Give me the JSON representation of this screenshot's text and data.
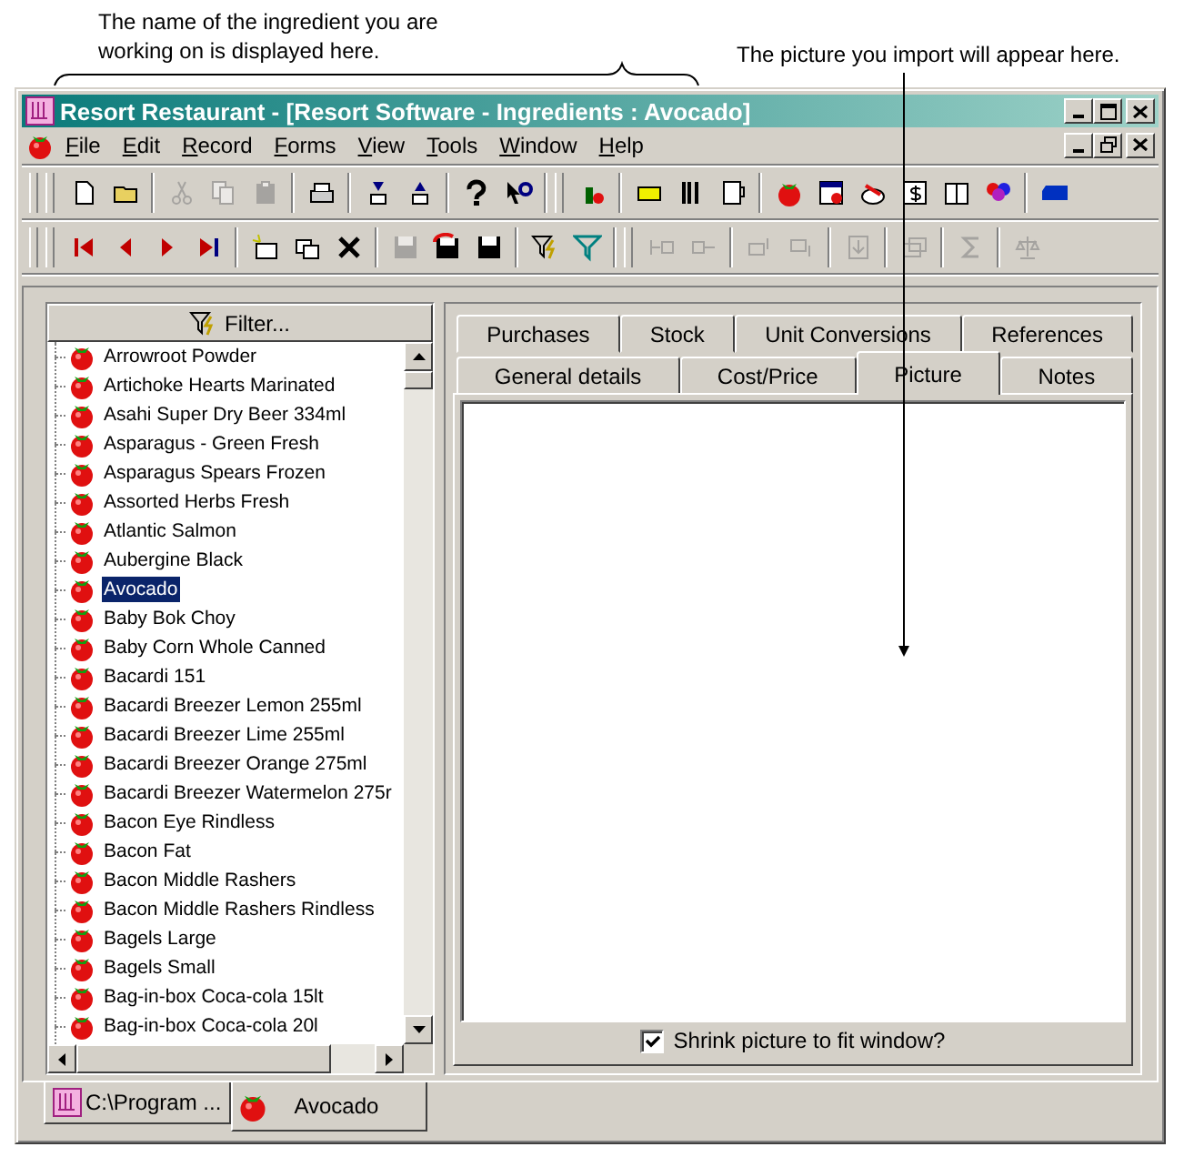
{
  "annotations": [
    {
      "kind": "bracket",
      "text": "The name of the ingredient you are working on is displayed here."
    },
    {
      "kind": "arrow",
      "text": "The picture you import will appear here."
    }
  ],
  "window": {
    "title": "Resort Restaurant - [Resort Software - Ingredients : Avocado]"
  },
  "menu": [
    "File",
    "Edit",
    "Record",
    "Forms",
    "View",
    "Tools",
    "Window",
    "Help"
  ],
  "toolbar_1": [
    {
      "disabled": false
    },
    {
      "disabled": false
    },
    {
      "disabled": true
    },
    {
      "disabled": true
    },
    {
      "disabled": true
    },
    {
      "disabled": false
    },
    {
      "disabled": false
    },
    {
      "disabled": false
    },
    {
      "disabled": false
    },
    {
      "disabled": false
    },
    {
      "disabled": false
    },
    {
      "disabled": false
    },
    {
      "disabled": false
    },
    {
      "disabled": false
    },
    {
      "disabled": false
    },
    {
      "disabled": false
    },
    {
      "disabled": false
    },
    {
      "disabled": false
    },
    {
      "disabled": false
    },
    {
      "disabled": false
    },
    {
      "disabled": false
    }
  ],
  "toolbar_2": [
    {
      "disabled": false
    },
    {
      "disabled": false
    },
    {
      "disabled": false
    },
    {
      "disabled": false
    },
    {
      "disabled": false
    },
    {
      "disabled": false
    },
    {
      "disabled": false
    },
    {
      "disabled": true
    },
    {
      "disabled": false
    },
    {
      "disabled": false
    },
    {
      "disabled": false
    },
    {
      "disabled": false
    },
    {
      "disabled": true
    },
    {
      "disabled": true
    },
    {
      "disabled": true
    },
    {
      "disabled": true
    },
    {
      "disabled": true
    },
    {
      "disabled": true
    },
    {
      "disabled": true
    },
    {
      "disabled": true
    }
  ],
  "filter_button": "Filter...",
  "ingredients": [
    {
      "name": "Arrowroot Powder",
      "selected": false
    },
    {
      "name": "Artichoke Hearts Marinated",
      "selected": false
    },
    {
      "name": "Asahi Super Dry Beer 334ml",
      "selected": false
    },
    {
      "name": "Asparagus - Green Fresh",
      "selected": false
    },
    {
      "name": "Asparagus Spears Frozen",
      "selected": false
    },
    {
      "name": "Assorted Herbs Fresh",
      "selected": false
    },
    {
      "name": "Atlantic Salmon",
      "selected": false
    },
    {
      "name": "Aubergine Black",
      "selected": false
    },
    {
      "name": "Avocado",
      "selected": true
    },
    {
      "name": "Baby Bok Choy",
      "selected": false
    },
    {
      "name": "Baby Corn Whole Canned",
      "selected": false
    },
    {
      "name": "Bacardi 151",
      "selected": false
    },
    {
      "name": "Bacardi Breezer Lemon 255ml",
      "selected": false
    },
    {
      "name": "Bacardi Breezer Lime 255ml",
      "selected": false
    },
    {
      "name": "Bacardi Breezer Orange 275ml",
      "selected": false
    },
    {
      "name": "Bacardi Breezer Watermelon 275r",
      "selected": false
    },
    {
      "name": "Bacon Eye Rindless",
      "selected": false
    },
    {
      "name": "Bacon Fat",
      "selected": false
    },
    {
      "name": "Bacon Middle Rashers",
      "selected": false
    },
    {
      "name": "Bacon Middle Rashers Rindless",
      "selected": false
    },
    {
      "name": "Bagels Large",
      "selected": false
    },
    {
      "name": "Bagels Small",
      "selected": false
    },
    {
      "name": "Bag-in-box Coca-cola 15lt",
      "selected": false
    },
    {
      "name": "Bag-in-box Coca-cola 20l",
      "selected": false
    }
  ],
  "tab_rows": [
    [
      {
        "label": "Purchases",
        "selected": false
      },
      {
        "label": "Stock",
        "selected": false
      },
      {
        "label": "Unit Conversions",
        "selected": false
      },
      {
        "label": "References",
        "selected": false
      }
    ],
    [
      {
        "label": "General details",
        "selected": false
      },
      {
        "label": "Cost/Price",
        "selected": false
      },
      {
        "label": "Picture",
        "selected": true
      },
      {
        "label": "Notes",
        "selected": false
      }
    ]
  ],
  "shrink_checkbox": {
    "label": "Shrink picture to fit window?",
    "checked": true
  },
  "document_tabs": [
    {
      "label": "C:\\Program ...",
      "kind": "app",
      "selected": false
    },
    {
      "label": "Avocado",
      "kind": "ingredient",
      "selected": true
    }
  ]
}
